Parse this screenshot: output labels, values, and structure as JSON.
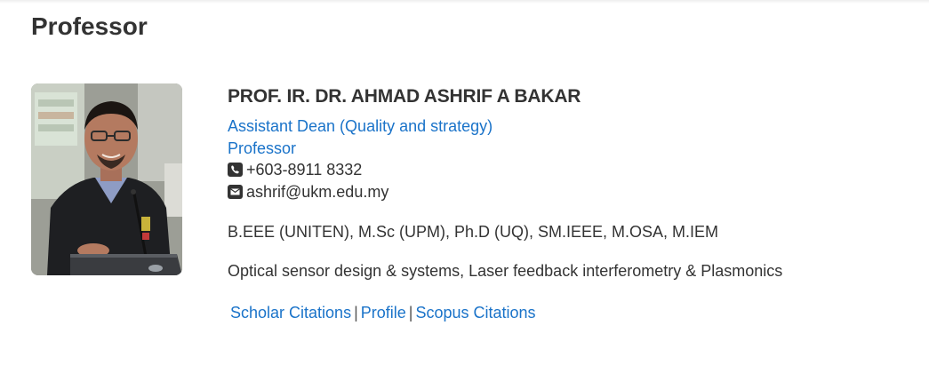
{
  "section": {
    "title": "Professor"
  },
  "profile": {
    "name": "PROF. IR. DR. AHMAD ASHRIF A BAKAR",
    "roles": [
      "Assistant Dean (Quality and strategy)",
      "Professor"
    ],
    "phone": "+603-8911 8332",
    "email": "ashrif@ukm.edu.my",
    "qualifications": "B.EEE (UNITEN), M.Sc (UPM), Ph.D (UQ), SM.IEEE, M.OSA, M.IEM",
    "research": "Optical sensor design & systems, Laser feedback interferometry & Plasmonics",
    "photo_icon": "person-photo",
    "phone_icon": "phone-square-icon",
    "email_icon": "envelope-square-icon"
  },
  "links": [
    {
      "label": "Scholar Citations"
    },
    {
      "label": "Profile"
    },
    {
      "label": "Scopus Citations"
    }
  ],
  "link_separator": "|",
  "colors": {
    "link": "#1a73c9",
    "text": "#333333"
  }
}
